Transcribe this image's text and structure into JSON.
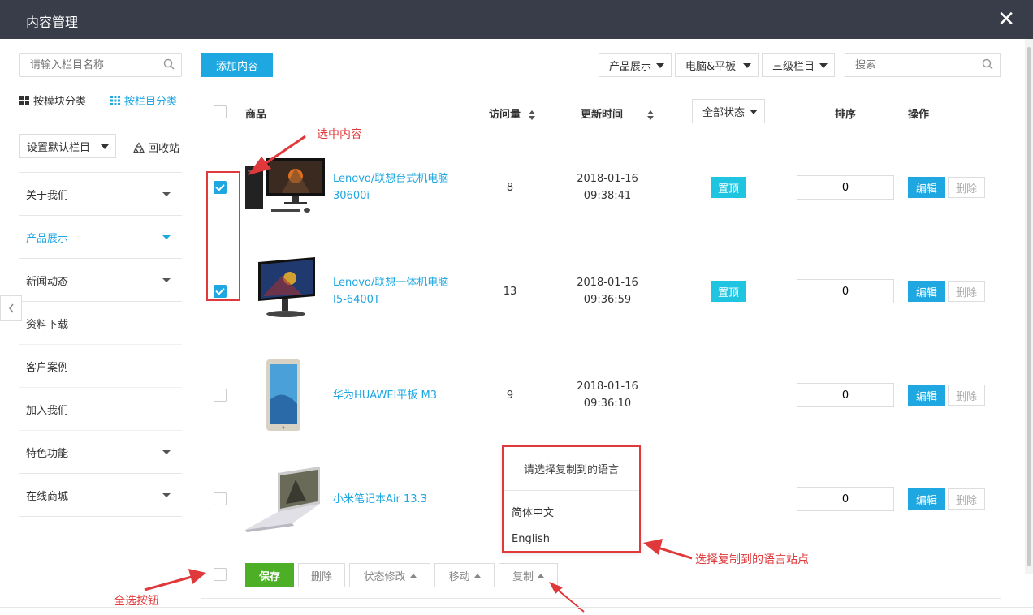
{
  "header": {
    "title": "内容管理",
    "close_label": "✕"
  },
  "sidebar": {
    "search_placeholder": "请输入栏目名称",
    "view_by_module": "按模块分类",
    "view_by_column": "按栏目分类",
    "default_column": "设置默认栏目",
    "recycle": "回收站",
    "menu": [
      {
        "label": "关于我们",
        "expandable": true,
        "active": false
      },
      {
        "label": "产品展示",
        "expandable": true,
        "active": true
      },
      {
        "label": "新闻动态",
        "expandable": true,
        "active": false
      },
      {
        "label": "资料下载",
        "expandable": false,
        "active": false
      },
      {
        "label": "客户案例",
        "expandable": false,
        "active": false
      },
      {
        "label": "加入我们",
        "expandable": false,
        "active": false
      },
      {
        "label": "特色功能",
        "expandable": true,
        "active": false
      },
      {
        "label": "在线商城",
        "expandable": true,
        "active": false
      }
    ]
  },
  "toolbar": {
    "add_label": "添加内容",
    "filters": [
      "产品展示",
      "电脑&平板",
      "三级栏目"
    ],
    "search_placeholder": "搜索"
  },
  "table": {
    "headers": {
      "product": "商品",
      "visits": "访问量",
      "updated": "更新时间",
      "status_filter": "全部状态",
      "order": "排序",
      "actions": "操作"
    },
    "rows": [
      {
        "name_line1": "Lenovo/联想台式机电脑",
        "name_line2": "30600i",
        "visits": "8",
        "date": "2018-01-16",
        "time": "09:38:41",
        "pinned": true,
        "pin_label": "置顶",
        "order": "0",
        "checked": true,
        "image": "desktop-pc"
      },
      {
        "name_line1": "Lenovo/联想一体机电脑",
        "name_line2": "I5-6400T",
        "visits": "13",
        "date": "2018-01-16",
        "time": "09:36:59",
        "pinned": true,
        "pin_label": "置顶",
        "order": "0",
        "checked": true,
        "image": "all-in-one-pc"
      },
      {
        "name_line1": "华为HUAWEI平板 M3",
        "name_line2": "",
        "visits": "9",
        "date": "2018-01-16",
        "time": "09:36:10",
        "pinned": false,
        "pin_label": "",
        "order": "0",
        "checked": false,
        "image": "tablet"
      },
      {
        "name_line1": "小米笔记本Air 13.3",
        "name_line2": "",
        "visits": "",
        "date": "",
        "time": "",
        "pinned": false,
        "pin_label": "",
        "order": "0",
        "checked": false,
        "image": "laptop"
      }
    ],
    "edit_label": "编辑",
    "delete_label": "删除"
  },
  "footer": {
    "save": "保存",
    "delete": "删除",
    "status_change": "状态修改",
    "move": "移动",
    "copy": "复制"
  },
  "copy_dropdown": {
    "title": "请选择复制到的语言",
    "options": [
      "简体中文",
      "English"
    ]
  },
  "annotations": {
    "select_content": "选中内容",
    "choose_language": "选择复制到的语言站点",
    "select_all": "全选按钮"
  },
  "colors": {
    "accent": "#1ea7e1",
    "header_bg": "#393d49",
    "save_green": "#4caf26",
    "annotation_red": "#e0393b",
    "pin_cyan": "#1ec4e0"
  }
}
